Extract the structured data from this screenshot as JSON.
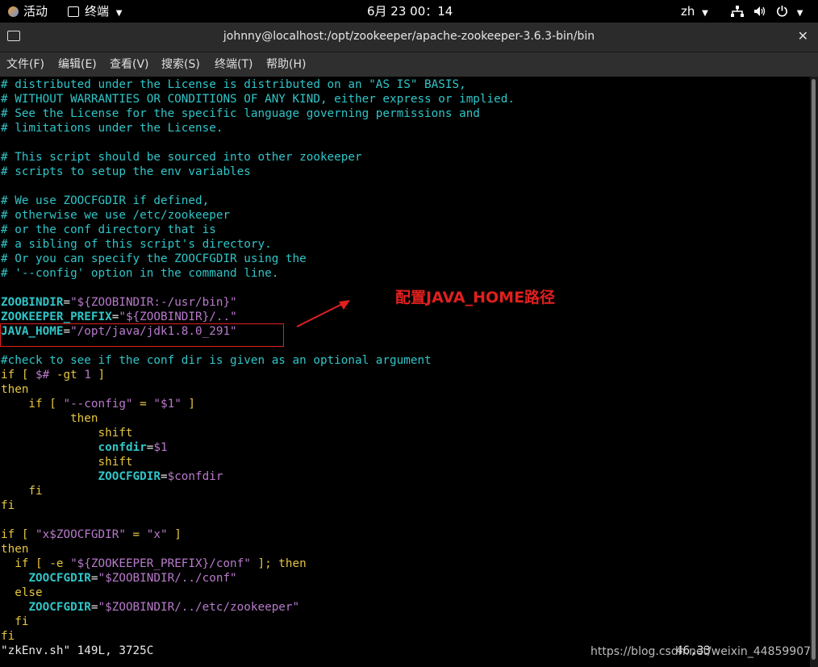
{
  "topbar": {
    "activities": "活动",
    "app_name": "终端",
    "clock": "6月 23  00：14",
    "language": "zh"
  },
  "window": {
    "title": "johnny@localhost:/opt/zookeeper/apache-zookeeper-3.6.3-bin/bin",
    "close": "✕"
  },
  "menu": [
    "文件(F)",
    "编辑(E)",
    "查看(V)",
    "搜索(S)",
    "终端(T)",
    "帮助(H)"
  ],
  "editor": {
    "lines": [
      [
        {
          "t": "# distributed under the License is distributed on an \"AS IS\" BASIS,",
          "c": "c"
        }
      ],
      [
        {
          "t": "# WITHOUT WARRANTIES OR CONDITIONS OF ANY KIND, either express or implied.",
          "c": "c"
        }
      ],
      [
        {
          "t": "# See the License for the specific language governing permissions and",
          "c": "c"
        }
      ],
      [
        {
          "t": "# limitations under the License.",
          "c": "c"
        }
      ],
      [],
      [
        {
          "t": "# This script should be sourced into other zookeeper",
          "c": "c"
        }
      ],
      [
        {
          "t": "# scripts to setup the env variables",
          "c": "c"
        }
      ],
      [],
      [
        {
          "t": "# We use ZOOCFGDIR if defined,",
          "c": "c"
        }
      ],
      [
        {
          "t": "# otherwise we use /etc/zookeeper",
          "c": "c"
        }
      ],
      [
        {
          "t": "# or the conf directory that is",
          "c": "c"
        }
      ],
      [
        {
          "t": "# a sibling of this script's directory.",
          "c": "c"
        }
      ],
      [
        {
          "t": "# Or you can specify the ZOOCFGDIR using the",
          "c": "c"
        }
      ],
      [
        {
          "t": "# '--config' option in the command line.",
          "c": "c"
        }
      ],
      [],
      [
        {
          "t": "ZOOBINDIR",
          "c": "v"
        },
        {
          "t": "=",
          "c": "w"
        },
        {
          "t": "\"${ZOOBINDIR:-/usr/bin}\"",
          "c": "p"
        }
      ],
      [
        {
          "t": "ZOOKEEPER_PREFIX",
          "c": "v"
        },
        {
          "t": "=",
          "c": "w"
        },
        {
          "t": "\"${ZOOBINDIR}/..\"",
          "c": "p"
        }
      ],
      [
        {
          "t": "JAVA_HOME",
          "c": "v"
        },
        {
          "t": "=",
          "c": "w"
        },
        {
          "t": "\"/opt/java/jdk1.8.0_291\"",
          "c": "p"
        }
      ],
      [],
      [
        {
          "t": "#check to see if the conf dir is given as an optional argument",
          "c": "c"
        }
      ],
      [
        {
          "t": "if [ ",
          "c": "y"
        },
        {
          "t": "$# ",
          "c": "p"
        },
        {
          "t": "-gt ",
          "c": "y"
        },
        {
          "t": "1",
          "c": "p"
        },
        {
          "t": " ]",
          "c": "y"
        }
      ],
      [
        {
          "t": "then",
          "c": "y"
        }
      ],
      [
        {
          "t": "    if [ ",
          "c": "y"
        },
        {
          "t": "\"--config\"",
          "c": "p"
        },
        {
          "t": " = ",
          "c": "y"
        },
        {
          "t": "\"$1\"",
          "c": "p"
        },
        {
          "t": " ]",
          "c": "y"
        }
      ],
      [
        {
          "t": "          then",
          "c": "y"
        }
      ],
      [
        {
          "t": "              shift",
          "c": "y"
        }
      ],
      [
        {
          "t": "              ",
          "c": "w"
        },
        {
          "t": "confdir",
          "c": "v"
        },
        {
          "t": "=",
          "c": "w"
        },
        {
          "t": "$1",
          "c": "p"
        }
      ],
      [
        {
          "t": "              shift",
          "c": "y"
        }
      ],
      [
        {
          "t": "              ",
          "c": "w"
        },
        {
          "t": "ZOOCFGDIR",
          "c": "v"
        },
        {
          "t": "=",
          "c": "w"
        },
        {
          "t": "$confdir",
          "c": "p"
        }
      ],
      [
        {
          "t": "    fi",
          "c": "y"
        }
      ],
      [
        {
          "t": "fi",
          "c": "y"
        }
      ],
      [],
      [
        {
          "t": "if [ ",
          "c": "y"
        },
        {
          "t": "\"x$ZOOCFGDIR\"",
          "c": "p"
        },
        {
          "t": " = ",
          "c": "y"
        },
        {
          "t": "\"x\"",
          "c": "p"
        },
        {
          "t": " ]",
          "c": "y"
        }
      ],
      [
        {
          "t": "then",
          "c": "y"
        }
      ],
      [
        {
          "t": "  if [ -e ",
          "c": "y"
        },
        {
          "t": "\"${ZOOKEEPER_PREFIX}/conf\"",
          "c": "p"
        },
        {
          "t": " ]; then",
          "c": "y"
        }
      ],
      [
        {
          "t": "    ",
          "c": "w"
        },
        {
          "t": "ZOOCFGDIR",
          "c": "v"
        },
        {
          "t": "=",
          "c": "w"
        },
        {
          "t": "\"$ZOOBINDIR/../conf\"",
          "c": "p"
        }
      ],
      [
        {
          "t": "  else",
          "c": "y"
        }
      ],
      [
        {
          "t": "    ",
          "c": "w"
        },
        {
          "t": "ZOOCFGDIR",
          "c": "v"
        },
        {
          "t": "=",
          "c": "w"
        },
        {
          "t": "\"$ZOOBINDIR/../etc/zookeeper\"",
          "c": "p"
        }
      ],
      [
        {
          "t": "  fi",
          "c": "y"
        }
      ],
      [
        {
          "t": "fi",
          "c": "y"
        }
      ]
    ],
    "status_file": "\"zkEnv.sh\" 149L, 3725C",
    "cursor_pos": "46,33"
  },
  "annotation": "配置JAVA_HOME路径",
  "watermark": "https://blog.csdn.net/weixin_44859907",
  "colors": {
    "comment": "#30c5c8",
    "keyword": "#e6c640",
    "string": "#b87acb",
    "annotation": "#e0201e"
  }
}
